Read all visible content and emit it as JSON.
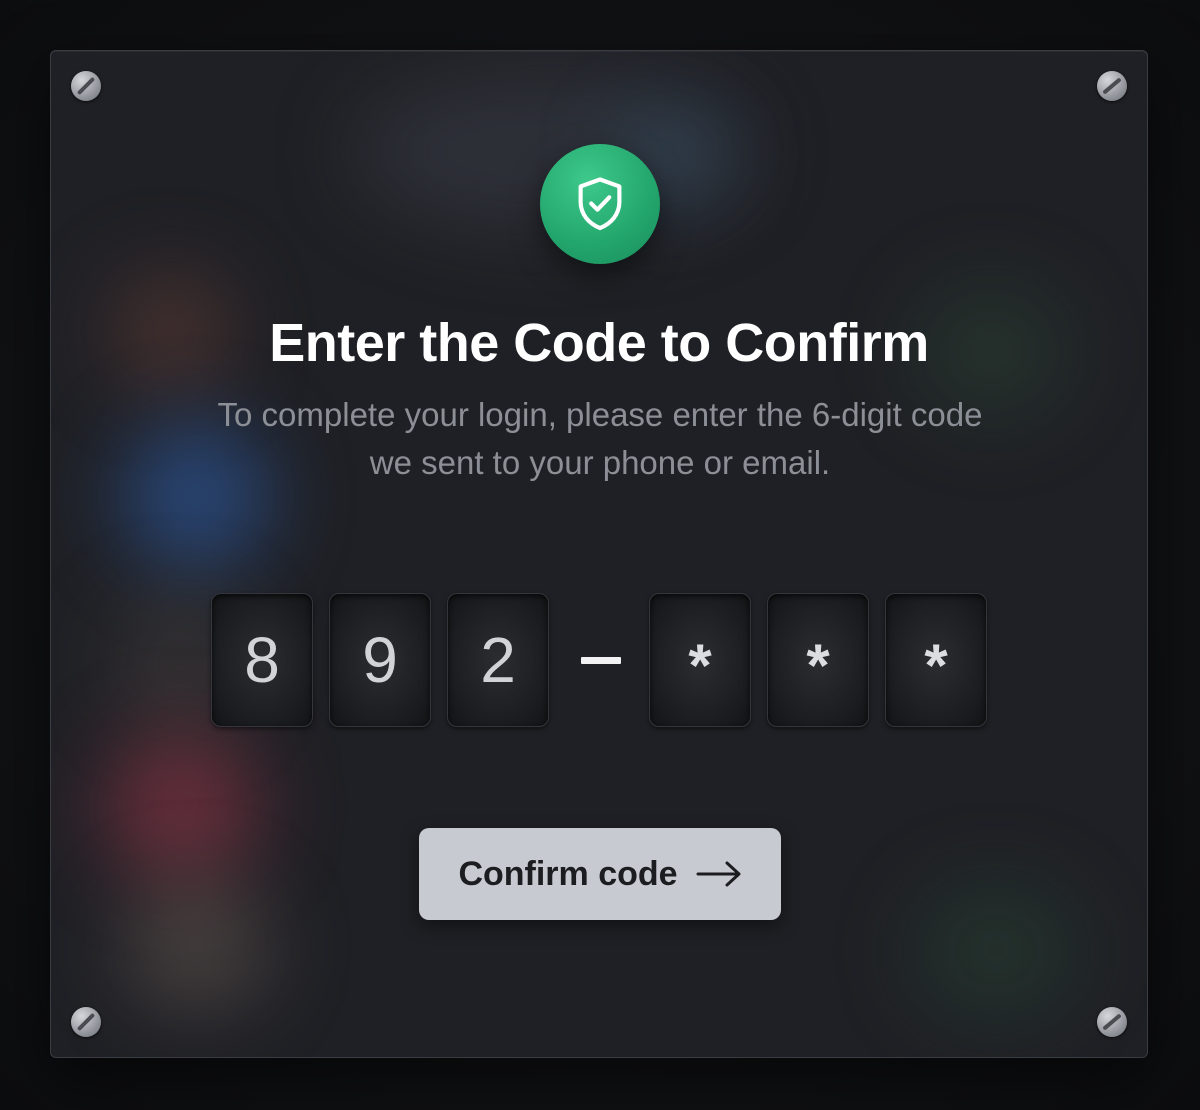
{
  "dialog": {
    "title": "Enter the Code to Confirm",
    "subtitle": "To complete your login, please enter the 6-digit code we sent to your phone or email."
  },
  "code": {
    "digits": [
      "8",
      "9",
      "2",
      "*",
      "*",
      "*"
    ],
    "separator": "–"
  },
  "confirm_button": {
    "label": "Confirm code",
    "icon": "arrow-right-icon"
  },
  "badge": {
    "icon": "shield-check-icon",
    "color": "#27ae70"
  },
  "colors": {
    "panel": "#1f2025",
    "button": "#c8cad1",
    "title": "#ffffff",
    "subtitle": "#8d8f97"
  }
}
